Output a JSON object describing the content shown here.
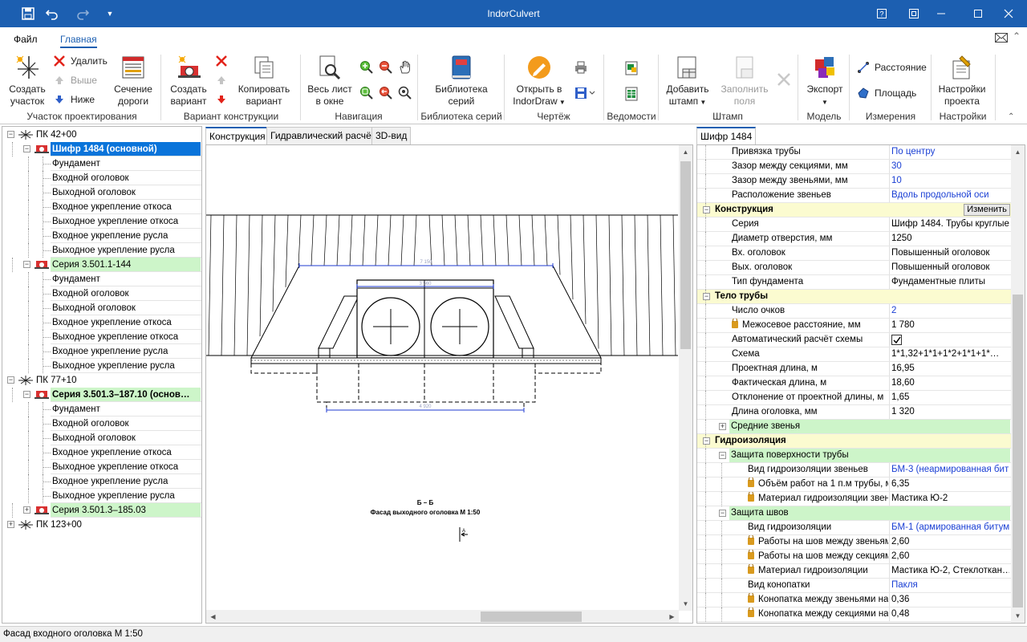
{
  "app": {
    "title": "IndorCulvert"
  },
  "menu": {
    "file": "Файл",
    "home": "Главная"
  },
  "ribbon": {
    "create_section": "Создать участок",
    "delete": "Удалить",
    "up": "Выше",
    "down": "Ниже",
    "road_section": "Сечение дороги",
    "create_variant": "Создать вариант",
    "copy_variant": "Копировать вариант",
    "whole_sheet": "Весь лист в окне",
    "series_library": "Библиотека серий",
    "open_indordraw": "Открыть в IndorDraw",
    "add_stamp": "Добавить штамп",
    "fill_fields": "Заполнить поля",
    "export": "Экспорт",
    "distance": "Расстояние",
    "area": "Площадь",
    "project_settings": "Настройки проекта",
    "groups": {
      "section": "Участок проектирования",
      "variant": "Вариант конструкции",
      "navigation": "Навигация",
      "library": "Библиотека серий",
      "drawing": "Чертёж",
      "sheets": "Ведомости",
      "stamp": "Штамп",
      "model": "Модель",
      "measure": "Измерения",
      "settings": "Настройки"
    }
  },
  "tree": {
    "items": [
      {
        "label": "ПК 42+00",
        "level": 0,
        "type": "pk",
        "expanded": true
      },
      {
        "label": "Шифр 1484 (основной)",
        "level": 1,
        "type": "variant",
        "selected": true,
        "expanded": true
      },
      {
        "label": "Фундамент",
        "level": 2
      },
      {
        "label": "Входной оголовок",
        "level": 2
      },
      {
        "label": "Выходной оголовок",
        "level": 2
      },
      {
        "label": "Входное укрепление откоса",
        "level": 2
      },
      {
        "label": "Выходное укрепление откоса",
        "level": 2
      },
      {
        "label": "Входное укрепление русла",
        "level": 2
      },
      {
        "label": "Выходное укрепление русла",
        "level": 2
      },
      {
        "label": "Серия 3.501.1-144",
        "level": 1,
        "type": "variant",
        "green": true,
        "expanded": true
      },
      {
        "label": "Фундамент",
        "level": 2
      },
      {
        "label": "Входной оголовок",
        "level": 2
      },
      {
        "label": "Выходной оголовок",
        "level": 2
      },
      {
        "label": "Входное укрепление откоса",
        "level": 2
      },
      {
        "label": "Выходное укрепление откоса",
        "level": 2
      },
      {
        "label": "Входное укрепление русла",
        "level": 2
      },
      {
        "label": "Выходное укрепление русла",
        "level": 2
      },
      {
        "label": "ПК 77+10",
        "level": 0,
        "type": "pk",
        "expanded": true
      },
      {
        "label": "Серия 3.501.3–187.10 (основ…",
        "level": 1,
        "type": "variant",
        "green": true,
        "bold": true,
        "expanded": true
      },
      {
        "label": "Фундамент",
        "level": 2
      },
      {
        "label": "Входной оголовок",
        "level": 2
      },
      {
        "label": "Выходной оголовок",
        "level": 2
      },
      {
        "label": "Входное укрепление откоса",
        "level": 2
      },
      {
        "label": "Выходное укрепление откоса",
        "level": 2
      },
      {
        "label": "Входное укрепление русла",
        "level": 2
      },
      {
        "label": "Выходное укрепление русла",
        "level": 2
      },
      {
        "label": "Серия 3.501.3–185.03",
        "level": 1,
        "type": "variant",
        "green": true,
        "expanded": false
      },
      {
        "label": "ПК 123+00",
        "level": 0,
        "type": "pk",
        "expanded": false
      }
    ]
  },
  "center": {
    "tabs": [
      "Конструкция",
      "Гидравлический расчёт",
      "3D-вид"
    ],
    "active_tab": 0,
    "drawing": {
      "section_label": "Б – Б",
      "caption": "Фасад выходного оголовка М 1:50",
      "mark": "А"
    }
  },
  "right": {
    "tab": "Шифр 1484",
    "change_button": "Изменить",
    "rows": [
      {
        "k": "Привязка трубы",
        "v": "По центру",
        "blue": true,
        "indent": 1
      },
      {
        "k": "Зазор между секциями, мм",
        "v": "30",
        "blue": true,
        "indent": 1
      },
      {
        "k": "Зазор между звеньями, мм",
        "v": "10",
        "blue": true,
        "indent": 1
      },
      {
        "k": "Расположение звеньев",
        "v": "Вдоль продольной оси",
        "blue": true,
        "indent": 1
      },
      {
        "k": "Конструкция",
        "cat": true,
        "expanded": true,
        "button": true
      },
      {
        "k": "Серия",
        "v": "Шифр 1484. Трубы круглые",
        "indent": 1
      },
      {
        "k": "Диаметр отверстия, мм",
        "v": "1250",
        "indent": 1
      },
      {
        "k": "Вх. оголовок",
        "v": "Повышенный оголовок",
        "indent": 1
      },
      {
        "k": "Вых. оголовок",
        "v": "Повышенный оголовок",
        "indent": 1
      },
      {
        "k": "Тип фундамента",
        "v": "Фундаментные плиты",
        "indent": 1
      },
      {
        "k": "Тело трубы",
        "cat": true,
        "expanded": true
      },
      {
        "k": "Число очков",
        "v": "2",
        "blue": true,
        "indent": 1
      },
      {
        "k": "Межосевое расстояние, мм",
        "v": "1 780",
        "indent": 1,
        "lock": true
      },
      {
        "k": "Автоматический расчёт схемы",
        "v": "",
        "indent": 1,
        "check": true
      },
      {
        "k": "Схема",
        "v": "1*1,32+1*1+1*2+1*1+1*…",
        "indent": 1
      },
      {
        "k": "Проектная длина, м",
        "v": "16,95",
        "indent": 1
      },
      {
        "k": "Фактическая длина, м",
        "v": "18,60",
        "indent": 1
      },
      {
        "k": "Отклонение от проектной длины, м",
        "v": "1,65",
        "indent": 1
      },
      {
        "k": "Длина оголовка, мм",
        "v": "1 320",
        "indent": 1
      },
      {
        "k": "Средние звенья",
        "sub": true,
        "expanded": false,
        "indent": 1
      },
      {
        "k": "Гидроизоляция",
        "cat": true,
        "expanded": true
      },
      {
        "k": "Защита поверхности трубы",
        "sub": true,
        "expanded": true,
        "indent": 1
      },
      {
        "k": "Вид гидроизоляции звеньев",
        "v": "БМ-3 (неармированная бит…",
        "blue": true,
        "indent": 2
      },
      {
        "k": "Объём работ на 1 п.м трубы, м",
        "v": "6,35",
        "indent": 2,
        "lock": true
      },
      {
        "k": "Материал гидроизоляции звеньев",
        "v": "Мастика Ю-2",
        "indent": 2,
        "lock": true
      },
      {
        "k": "Защита швов",
        "sub": true,
        "expanded": true,
        "indent": 1
      },
      {
        "k": "Вид гидроизоляции",
        "v": "БМ-1 (армированная битум…",
        "blue": true,
        "indent": 2
      },
      {
        "k": "Работы на шов между звеньями",
        "v": "2,60",
        "indent": 2,
        "lock": true
      },
      {
        "k": "Работы на шов между секциями",
        "v": "2,60",
        "indent": 2,
        "lock": true
      },
      {
        "k": "Материал гидроизоляции",
        "v": "Мастика Ю-2, Стеклоткан…",
        "indent": 2,
        "lock": true
      },
      {
        "k": "Вид конопатки",
        "v": "Пакля",
        "blue": true,
        "indent": 2
      },
      {
        "k": "Конопатка между звеньями на",
        "v": "0,36",
        "indent": 2,
        "lock": true
      },
      {
        "k": "Конопатка между секциями на",
        "v": "0,48",
        "indent": 2,
        "lock": true
      }
    ]
  },
  "status": {
    "text": "Фасад входного оголовка М 1:50"
  },
  "colors": {
    "title_bar": "#1c5fb1",
    "selection": "#0a74da",
    "green_row": "#cdf5c9",
    "category_row": "#fbfbd0",
    "blue_value": "#1a3fd4"
  }
}
